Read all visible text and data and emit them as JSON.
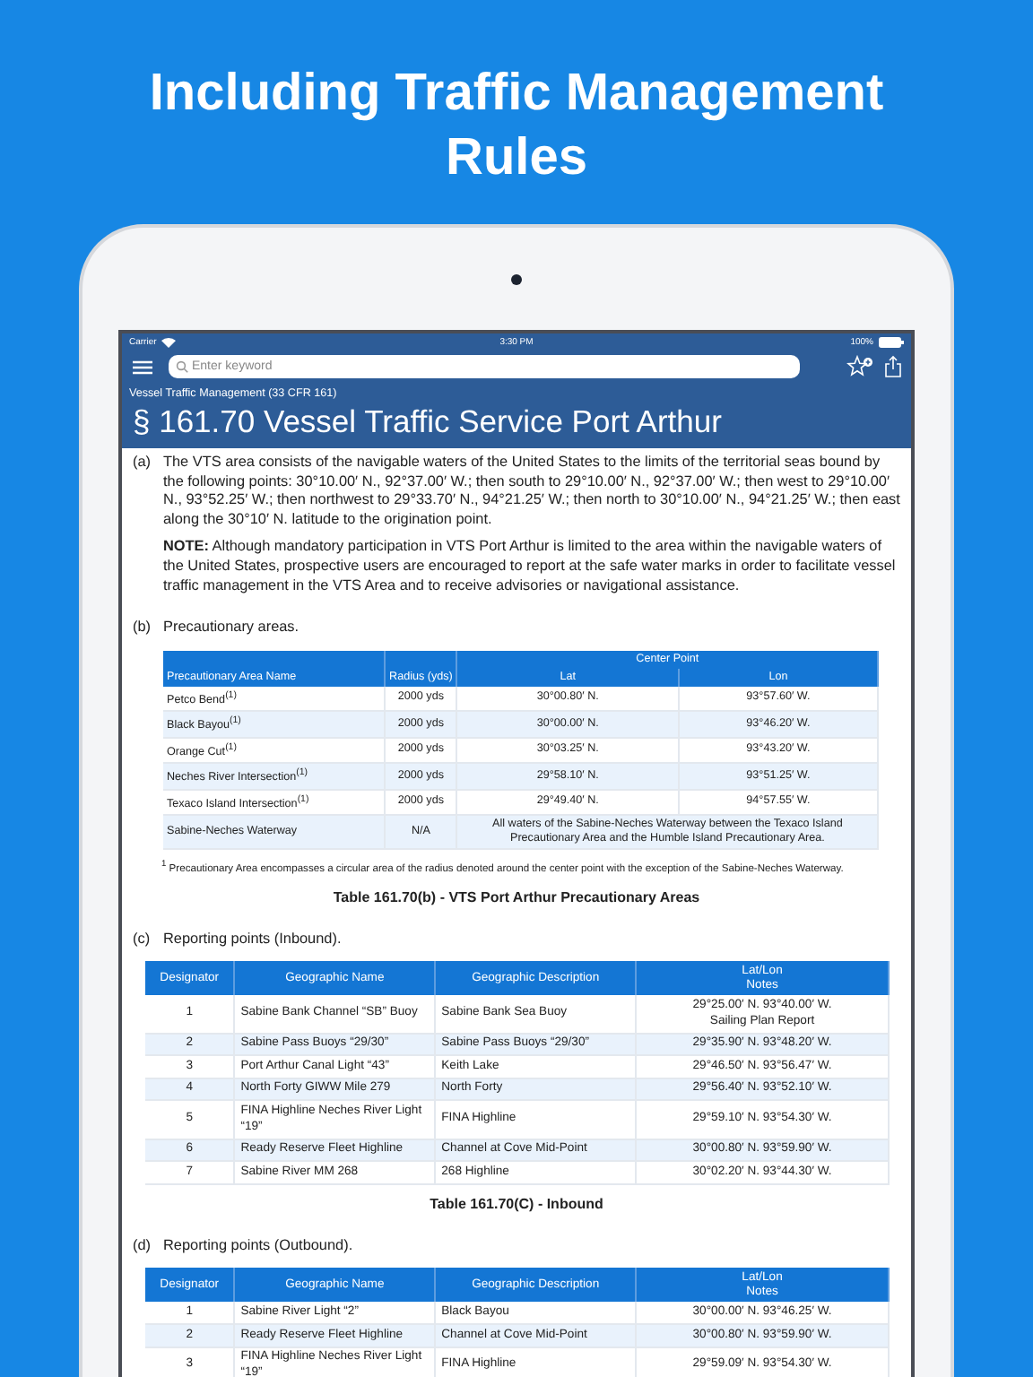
{
  "headline": "Including Traffic Management Rules",
  "status_bar": {
    "carrier": "Carrier",
    "time": "3:30 PM",
    "battery": "100%"
  },
  "search": {
    "placeholder": "Enter keyword"
  },
  "breadcrumb": "Vessel Traffic Management (33 CFR 161)",
  "title": "§ 161.70 Vessel Traffic Service Port Arthur",
  "sections": [
    {
      "kind": "paragraph",
      "marker": "(a)",
      "text": "The VTS area consists of the navigable waters of the United States to the limits of the territorial seas bound by the following points: 30°10.00′ N., 92°37.00′ W.; then south to 29°10.00′ N., 92°37.00′ W.; then west to 29°10.00′ N., 93°52.25′ W.; then northwest to 29°33.70′ N., 94°21.25′ W.; then north to 30°10.00′ N., 94°21.25′ W.; then east along the 30°10′ N. latitude to the origination point.",
      "note": "**NOTE:** Although mandatory participation in VTS Port Arthur is limited to the area within the navigable waters of the United States, prospective users are encouraged to report at the safe water marks in order to facilitate vessel traffic management in the VTS Area and to receive advisories or navigational assistance."
    },
    {
      "kind": "table",
      "marker": "(b)",
      "text": "Precautionary areas.",
      "table": {
        "header_rows": [
          [
            {
              "text": "Precautionary Area Name",
              "rowspan": 2
            },
            {
              "text": "Radius (yds)",
              "rowspan": 2
            },
            {
              "text": "Center Point",
              "colspan": 2
            }
          ],
          [
            {
              "text": "Lat"
            },
            {
              "text": "Lon"
            }
          ]
        ],
        "rows": [
          [
            "Petco Bend$^{(1)}$",
            "2000 yds",
            "30°00.80′ N.",
            "93°57.60′ W."
          ],
          [
            "Black Bayou$^{(1)}$",
            "2000 yds",
            "30°00.00′ N.",
            "93°46.20′ W."
          ],
          [
            "Orange Cut$^{(1)}$",
            "2000 yds",
            "30°03.25′ N.",
            "93°43.20′ W."
          ],
          [
            "Neches River Intersection$^{(1)}$",
            "2000 yds",
            "29°58.10′ N.",
            "93°51.25′ W."
          ],
          [
            "Texaco Island Intersection$^{(1)}$",
            "2000 yds",
            "29°49.40′ N.",
            "94°57.55′ W."
          ],
          [
            "Sabine-Neches Waterway",
            "N/A",
            {
              "text": "All waters of the Sabine-Neches Waterway between the Texaco Island Precautionary Area and the Humble Island Precautionary Area.",
              "colspan": 2
            }
          ]
        ]
      },
      "footnote": "$^{1}$ Precautionary Area encompasses a circular area of the radius denoted around the center point with the exception of the Sabine-Neches Waterway.",
      "caption": "Table 161.70(b) - VTS Port Arthur Precautionary Areas"
    },
    {
      "kind": "table",
      "marker": "(c)",
      "text": "Reporting points (Inbound).",
      "table": {
        "columns": [
          {
            "label": "Designator"
          },
          {
            "label": "Geographic Name"
          },
          {
            "label": "Geographic Description"
          },
          {
            "label": "Lat/Lon\nNotes"
          }
        ],
        "rows": [
          [
            "1",
            "Sabine Bank Channel “SB” Buoy",
            "Sabine Bank Sea Buoy",
            "29°25.00′ N. 93°40.00′ W.\nSailing Plan Report"
          ],
          [
            "2",
            "Sabine Pass Buoys “29/30”",
            "Sabine Pass Buoys “29/30”",
            "29°35.90′ N. 93°48.20′ W."
          ],
          [
            "3",
            "Port Arthur Canal Light “43”",
            "Keith Lake",
            "29°46.50′ N. 93°56.47′ W."
          ],
          [
            "4",
            "North Forty GIWW Mile 279",
            "North Forty",
            "29°56.40′ N. 93°52.10′ W."
          ],
          [
            "5",
            "FINA Highline Neches River Light “19”",
            "FINA Highline",
            "29°59.10′ N. 93°54.30′ W."
          ],
          [
            "6",
            "Ready Reserve Fleet Highline",
            "Channel at Cove Mid-Point",
            "30°00.80′ N. 93°59.90′ W."
          ],
          [
            "7",
            "Sabine River MM 268",
            "268 Highline",
            "30°02.20′ N. 93°44.30′ W."
          ]
        ]
      },
      "caption": "Table 161.70(C) - Inbound"
    },
    {
      "kind": "table",
      "marker": "(d)",
      "text": "Reporting points (Outbound).",
      "table": {
        "columns": [
          {
            "label": "Designator"
          },
          {
            "label": "Geographic Name"
          },
          {
            "label": "Geographic Description"
          },
          {
            "label": "Lat/Lon\nNotes"
          }
        ],
        "rows": [
          [
            "1",
            "Sabine River Light “2”",
            "Black Bayou",
            "30°00.00′ N. 93°46.25′ W."
          ],
          [
            "2",
            "Ready Reserve Fleet Highline",
            "Channel at Cove Mid-Point",
            "30°00.80′ N. 93°59.90′ W."
          ],
          [
            "3",
            "FINA Highline Neches River Light “19”",
            "FINA Highline",
            "29°59.09′ N. 93°54.30′ W."
          ]
        ]
      }
    }
  ]
}
